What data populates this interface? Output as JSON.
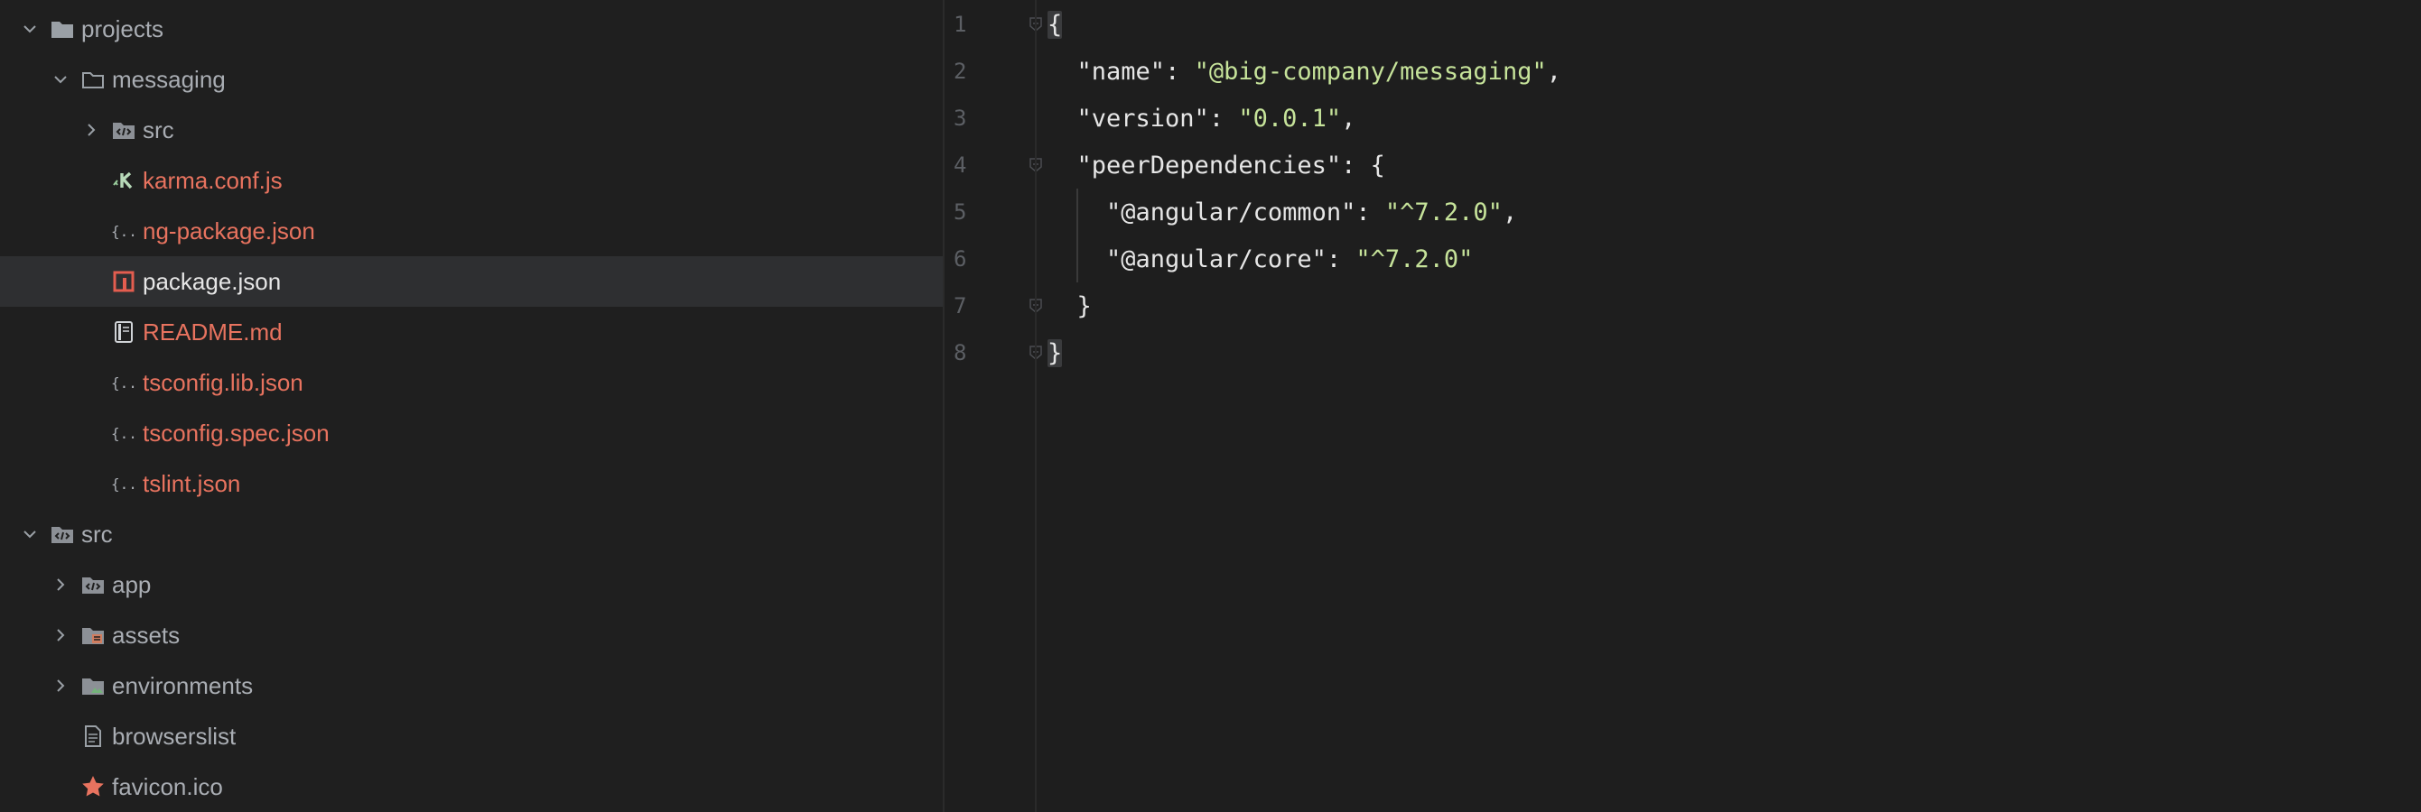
{
  "tree": [
    {
      "label": "projects",
      "chevron": "down",
      "icon": "folder-icon",
      "style": "normal"
    },
    {
      "label": "messaging",
      "chevron": "down",
      "icon": "folder-outline-icon",
      "style": "normal"
    },
    {
      "label": "src",
      "chevron": "right",
      "icon": "source-folder-icon",
      "style": "normal"
    },
    {
      "label": "karma.conf.js",
      "chevron": "",
      "icon": "karma-icon",
      "style": "modified"
    },
    {
      "label": "ng-package.json",
      "chevron": "",
      "icon": "json-icon",
      "style": "modified"
    },
    {
      "label": "package.json",
      "chevron": "",
      "icon": "npm-icon",
      "style": "bright",
      "selected": true
    },
    {
      "label": "README.md",
      "chevron": "",
      "icon": "markdown-icon",
      "style": "modified"
    },
    {
      "label": "tsconfig.lib.json",
      "chevron": "",
      "icon": "json-icon",
      "style": "modified"
    },
    {
      "label": "tsconfig.spec.json",
      "chevron": "",
      "icon": "json-icon",
      "style": "modified"
    },
    {
      "label": "tslint.json",
      "chevron": "",
      "icon": "json-icon",
      "style": "modified"
    },
    {
      "label": "src",
      "chevron": "down",
      "icon": "source-folder-icon",
      "style": "normal"
    },
    {
      "label": "app",
      "chevron": "right",
      "icon": "source-folder-icon",
      "style": "normal"
    },
    {
      "label": "assets",
      "chevron": "right",
      "icon": "assets-folder-icon",
      "style": "normal"
    },
    {
      "label": "environments",
      "chevron": "right",
      "icon": "image-folder-icon",
      "style": "normal"
    },
    {
      "label": "browserslist",
      "chevron": "",
      "icon": "text-file-icon",
      "style": "normal"
    },
    {
      "label": "favicon.ico",
      "chevron": "",
      "icon": "star-icon",
      "style": "normal"
    }
  ],
  "editor": {
    "line_numbers": [
      "1",
      "2",
      "3",
      "4",
      "5",
      "6",
      "7",
      "8"
    ],
    "lines": [
      [
        {
          "t": "{",
          "c": "p"
        }
      ],
      [
        {
          "t": "  ",
          "c": "p"
        },
        {
          "t": "\"name\"",
          "c": "k"
        },
        {
          "t": ": ",
          "c": "p"
        },
        {
          "t": "\"@big-company/messaging\"",
          "c": "s"
        },
        {
          "t": ",",
          "c": "p"
        }
      ],
      [
        {
          "t": "  ",
          "c": "p"
        },
        {
          "t": "\"version\"",
          "c": "k"
        },
        {
          "t": ": ",
          "c": "p"
        },
        {
          "t": "\"0.0.1\"",
          "c": "s"
        },
        {
          "t": ",",
          "c": "p"
        }
      ],
      [
        {
          "t": "  ",
          "c": "p"
        },
        {
          "t": "\"peerDependencies\"",
          "c": "k"
        },
        {
          "t": ": {",
          "c": "p"
        }
      ],
      [
        {
          "t": "    ",
          "c": "p"
        },
        {
          "t": "\"@angular/common\"",
          "c": "k"
        },
        {
          "t": ": ",
          "c": "p"
        },
        {
          "t": "\"^7.2.0\"",
          "c": "s"
        },
        {
          "t": ",",
          "c": "p"
        }
      ],
      [
        {
          "t": "    ",
          "c": "p"
        },
        {
          "t": "\"@angular/core\"",
          "c": "k"
        },
        {
          "t": ": ",
          "c": "p"
        },
        {
          "t": "\"^7.2.0\"",
          "c": "s"
        }
      ],
      [
        {
          "t": "  }",
          "c": "p"
        }
      ],
      [
        {
          "t": "}",
          "c": "p"
        }
      ]
    ]
  },
  "colors": {
    "modified": "#e8735f",
    "string": "#c6e39a",
    "text": "#e6e6e6",
    "muted": "#a9adb3",
    "selection": "#2e2f31"
  }
}
